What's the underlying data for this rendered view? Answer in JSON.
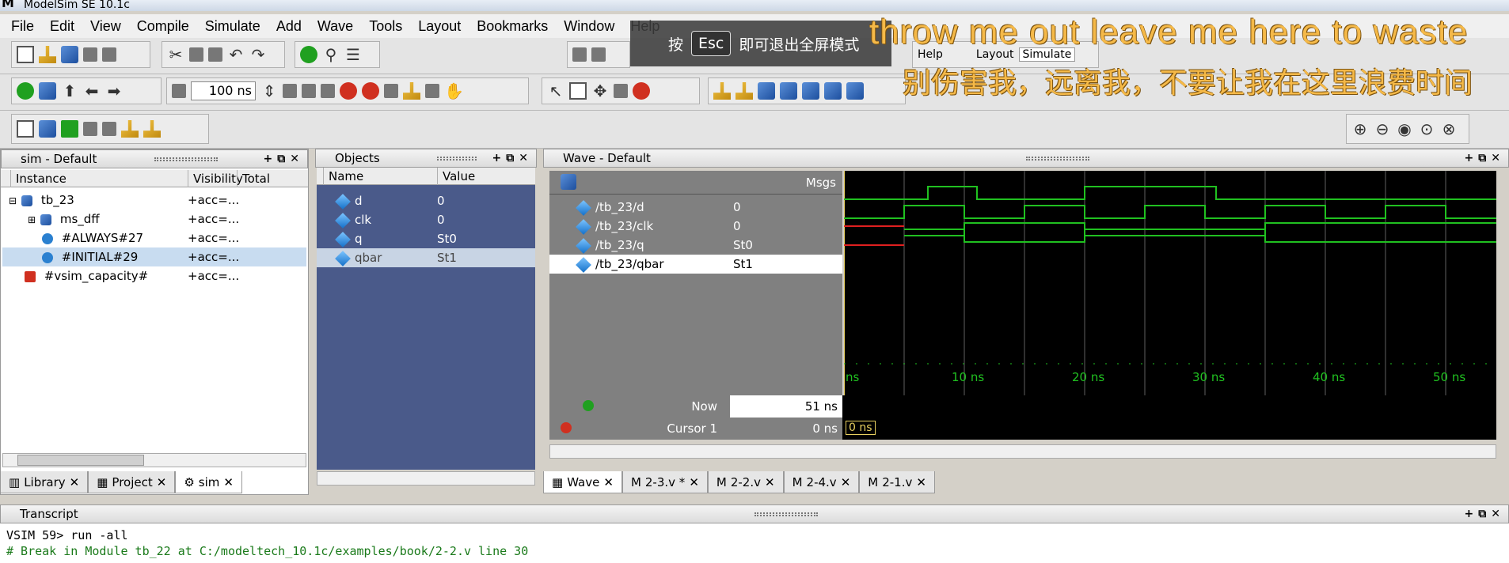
{
  "window": {
    "title": "ModelSim SE 10.1c"
  },
  "menu": [
    "File",
    "Edit",
    "View",
    "Compile",
    "Simulate",
    "Add",
    "Wave",
    "Tools",
    "Layout",
    "Bookmarks",
    "Window",
    "Help"
  ],
  "toolbar": {
    "run_length": "100 ns",
    "help_label": "Help",
    "layout_label": "Layout",
    "layout_value": "Simulate"
  },
  "overlay": {
    "prefix": "按",
    "key": "Esc",
    "suffix": "即可退出全屏模式"
  },
  "subtitles": {
    "english": "throw me out leave me here to waste",
    "chinese": "别伤害我，远离我，不要让我在这里浪费时间"
  },
  "sim_panel": {
    "title": "sim - Default",
    "columns": [
      "Instance",
      "Visibility",
      "Total covera"
    ],
    "rows": [
      {
        "name": "tb_23",
        "visibility": "+acc=..."
      },
      {
        "name": "ms_dff",
        "visibility": "+acc=..."
      },
      {
        "name": "#ALWAYS#27",
        "visibility": "+acc=..."
      },
      {
        "name": "#INITIAL#29",
        "visibility": "+acc=..."
      },
      {
        "name": "#vsim_capacity#",
        "visibility": "+acc=..."
      }
    ],
    "tabs": [
      "Library",
      "Project",
      "sim"
    ]
  },
  "objects_panel": {
    "title": "Objects",
    "columns": [
      "Name",
      "Value"
    ],
    "rows": [
      {
        "name": "d",
        "value": "0"
      },
      {
        "name": "clk",
        "value": "0"
      },
      {
        "name": "q",
        "value": "St0"
      },
      {
        "name": "qbar",
        "value": "St1"
      }
    ]
  },
  "wave_panel": {
    "title": "Wave - Default",
    "msgs_label": "Msgs",
    "signals": [
      {
        "path": "/tb_23/d",
        "value": "0"
      },
      {
        "path": "/tb_23/clk",
        "value": "0"
      },
      {
        "path": "/tb_23/q",
        "value": "St0"
      },
      {
        "path": "/tb_23/qbar",
        "value": "St1"
      }
    ],
    "now_label": "Now",
    "now_value": "51 ns",
    "cursor_label": "Cursor 1",
    "cursor_value": "0 ns",
    "cursor_marker": "0 ns",
    "ruler": [
      "ns",
      "10 ns",
      "20 ns",
      "30 ns",
      "40 ns",
      "50 ns"
    ],
    "tabs": [
      "Wave",
      "2-3.v *",
      "2-2.v",
      "2-4.v",
      "2-1.v"
    ]
  },
  "transcript": {
    "title": "Transcript",
    "lines": [
      "VSIM 59> run -all",
      "# Break in Module tb_22 at C:/modeltech_10.1c/examples/book/2-2.v line 30"
    ]
  },
  "colors": {
    "wave_green": "#20c020",
    "wave_red": "#e02020",
    "wave_bg": "#000000",
    "cursor_yellow": "#e8d060"
  }
}
